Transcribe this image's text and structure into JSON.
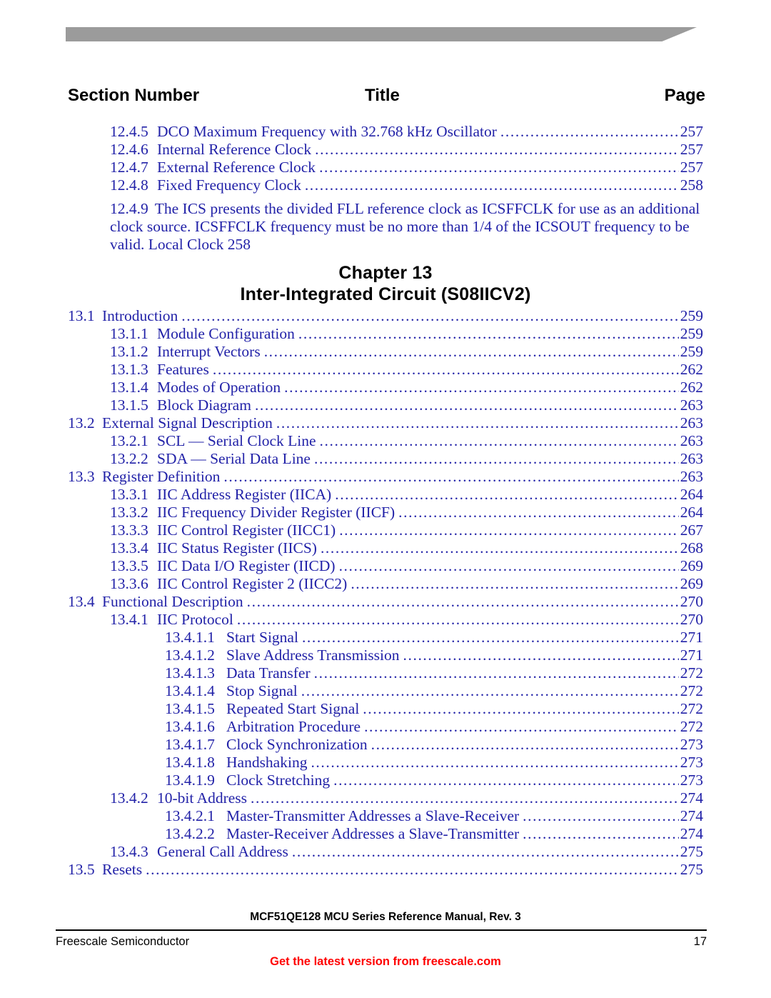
{
  "header": {
    "col_section": "Section Number",
    "col_title": "Title",
    "col_page": "Page"
  },
  "colors": {
    "toc_text": "#2222a8",
    "heading_text": "#000000",
    "promo_text": "#ff0000",
    "topbar": "#9b9b9b"
  },
  "chapter": {
    "line1": "Chapter 13",
    "line2": "Inter-Integrated Circuit (S08IICV2)"
  },
  "toc_top": [
    {
      "number": "12.4.5",
      "label": "DCO Maximum Frequency with 32.768 kHz Oscillator",
      "page": "257",
      "level": 3
    },
    {
      "number": "12.4.6",
      "label": "Internal Reference Clock",
      "page": "257",
      "level": 3
    },
    {
      "number": "12.4.7",
      "label": "External Reference Clock",
      "page": "257",
      "level": 3
    },
    {
      "number": "12.4.8",
      "label": "Fixed Frequency Clock",
      "page": "258",
      "level": 3
    }
  ],
  "toc_wrapped": {
    "number": "12.4.9",
    "line1": "The ICS presents the divided FLL reference clock as ICSFFCLK for use as an additional",
    "line2": "clock source. ICSFFCLK frequency must be no more than 1/4 of the ICSOUT frequency to be",
    "line3": "valid.  Local Clock 258"
  },
  "toc_bottom": [
    {
      "number": "13.1",
      "label": "Introduction",
      "page": "259",
      "level": 2
    },
    {
      "number": "13.1.1",
      "label": "Module Configuration",
      "page": "259",
      "level": 3
    },
    {
      "number": "13.1.2",
      "label": "Interrupt Vectors",
      "page": "259",
      "level": 3
    },
    {
      "number": "13.1.3",
      "label": "Features",
      "page": "262",
      "level": 3
    },
    {
      "number": "13.1.4",
      "label": "Modes of Operation",
      "page": "262",
      "level": 3
    },
    {
      "number": "13.1.5",
      "label": "Block Diagram",
      "page": "263",
      "level": 3
    },
    {
      "number": "13.2",
      "label": "External Signal Description",
      "page": "263",
      "level": 2
    },
    {
      "number": "13.2.1",
      "label": "SCL — Serial Clock Line",
      "page": "263",
      "level": 3
    },
    {
      "number": "13.2.2",
      "label": "SDA — Serial Data Line",
      "page": "263",
      "level": 3
    },
    {
      "number": "13.3",
      "label": "Register Definition",
      "page": "263",
      "level": 2
    },
    {
      "number": "13.3.1",
      "label": "IIC Address Register (IICA)",
      "page": "264",
      "level": 3
    },
    {
      "number": "13.3.2",
      "label": "IIC Frequency Divider Register (IICF)",
      "page": "264",
      "level": 3
    },
    {
      "number": "13.3.3",
      "label": "IIC Control Register (IICC1)",
      "page": "267",
      "level": 3
    },
    {
      "number": "13.3.4",
      "label": "IIC Status Register (IICS)",
      "page": "268",
      "level": 3
    },
    {
      "number": "13.3.5",
      "label": "IIC Data I/O Register (IICD)",
      "page": "269",
      "level": 3
    },
    {
      "number": "13.3.6",
      "label": "IIC Control Register 2 (IICC2)",
      "page": "269",
      "level": 3
    },
    {
      "number": "13.4",
      "label": "Functional Description",
      "page": "270",
      "level": 2
    },
    {
      "number": "13.4.1",
      "label": "IIC Protocol",
      "page": "270",
      "level": 3
    },
    {
      "number": "13.4.1.1",
      "label": "Start Signal",
      "page": "271",
      "level": 4
    },
    {
      "number": "13.4.1.2",
      "label": "Slave Address Transmission",
      "page": "271",
      "level": 4
    },
    {
      "number": "13.4.1.3",
      "label": "Data Transfer",
      "page": "272",
      "level": 4
    },
    {
      "number": "13.4.1.4",
      "label": "Stop Signal",
      "page": "272",
      "level": 4
    },
    {
      "number": "13.4.1.5",
      "label": "Repeated Start Signal",
      "page": "272",
      "level": 4
    },
    {
      "number": "13.4.1.6",
      "label": "Arbitration Procedure",
      "page": "272",
      "level": 4
    },
    {
      "number": "13.4.1.7",
      "label": "Clock Synchronization",
      "page": "273",
      "level": 4
    },
    {
      "number": "13.4.1.8",
      "label": "Handshaking",
      "page": "273",
      "level": 4
    },
    {
      "number": "13.4.1.9",
      "label": "Clock Stretching",
      "page": "273",
      "level": 4
    },
    {
      "number": "13.4.2",
      "label": "10-bit Address",
      "page": "274",
      "level": 3
    },
    {
      "number": "13.4.2.1",
      "label": "Master-Transmitter Addresses a Slave-Receiver",
      "page": "274",
      "level": 4
    },
    {
      "number": "13.4.2.2",
      "label": "Master-Receiver Addresses a Slave-Transmitter",
      "page": "274",
      "level": 4
    },
    {
      "number": "13.4.3",
      "label": "General Call Address",
      "page": "275",
      "level": 3
    },
    {
      "number": "13.5",
      "label": "Resets",
      "page": "275",
      "level": 2
    }
  ],
  "footer": {
    "manual_line": "MCF51QE128 MCU Series Reference Manual, Rev. 3",
    "company": "Freescale Semiconductor",
    "page_number": "17",
    "promo": "Get the latest version from freescale.com"
  }
}
